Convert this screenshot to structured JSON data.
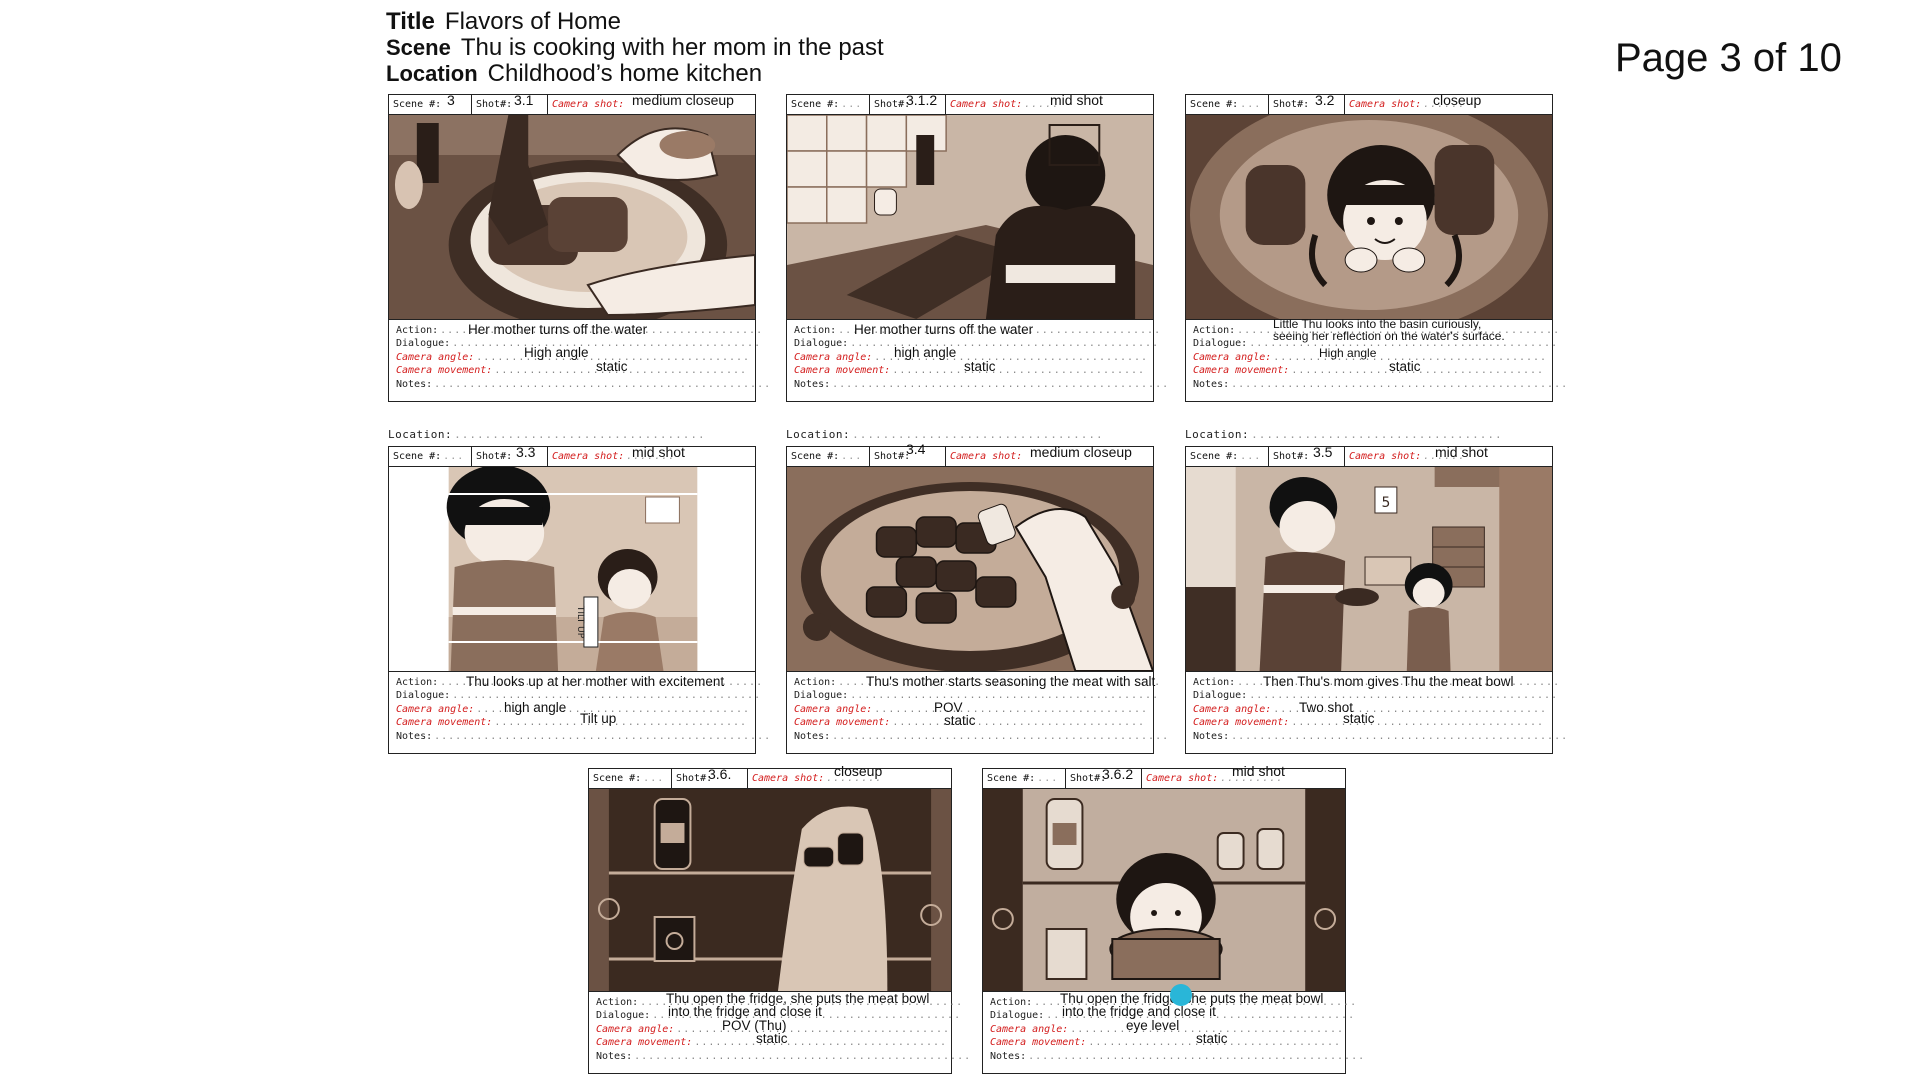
{
  "header": {
    "title_label": "Title",
    "title": "Flavors of Home",
    "scene_label": "Scene",
    "scene": "Thu is cooking with her mom in the past",
    "location_label": "Location",
    "location": "Childhood’s home kitchen"
  },
  "page": {
    "text": "Page 3 of 10"
  },
  "labels": {
    "scene": "Scene #:",
    "shot": "Shot#:",
    "camera_shot": "Camera shot:",
    "action": "Action:",
    "dialogue": "Dialogue:",
    "camera_angle": "Camera angle:",
    "camera_movement": "Camera movement:",
    "notes": "Notes:",
    "location": "Location:"
  },
  "colors": {
    "accent_red": "#d31c1c",
    "sepia_dark": "#3b2a20",
    "sepia_mid": "#8a6e5c",
    "sepia_light": "#cdb7a5",
    "pointer": "#29b6d8"
  },
  "panels": [
    {
      "scene": "3",
      "shot": "3.1",
      "camera_shot": "medium closeup",
      "action": "Her mother turns off the water",
      "camera_angle": "High angle",
      "camera_movement": "static"
    },
    {
      "scene": "",
      "shot": "3.1.2",
      "camera_shot": "mid shot",
      "action": "Her mother turns off the water",
      "camera_angle": "high angle",
      "camera_movement": "static"
    },
    {
      "scene": "",
      "shot": "3.2",
      "camera_shot": "closeup",
      "action": "Little Thu looks into the basin curiously,",
      "action2": "seeing her reflection on the water's surface.",
      "camera_angle": "High angle",
      "camera_movement": "static"
    },
    {
      "scene": "",
      "shot": "3.3",
      "camera_shot": "mid shot",
      "action": "Thu looks up at her mother with excitement",
      "camera_angle": "high angle",
      "camera_movement": "Tilt up",
      "overlay": "TILT UP"
    },
    {
      "scene": "",
      "shot": "3.4",
      "camera_shot": "medium closeup",
      "action": "Thu's mother starts seasoning the meat with salt",
      "camera_angle": "POV",
      "camera_movement": "static"
    },
    {
      "scene": "",
      "shot": "3.5",
      "camera_shot": "mid shot",
      "action": "Then Thu's mom gives Thu the meat bowl",
      "camera_angle": "Two shot",
      "camera_movement": "static",
      "calendar": "5"
    },
    {
      "scene": "",
      "shot": "3.6.",
      "camera_shot": "closeup",
      "action": "Thu open the fridge, she puts the meat bowl",
      "action2": "into the fridge and close it",
      "camera_angle": "POV (Thu)",
      "camera_movement": "static"
    },
    {
      "scene": "",
      "shot": "3.6.2",
      "camera_shot": "mid shot",
      "action": "Thu open the fridge, she puts the meat bowl",
      "action2": "into the fridge and close it",
      "camera_angle": "eye level",
      "camera_movement": "static"
    }
  ]
}
